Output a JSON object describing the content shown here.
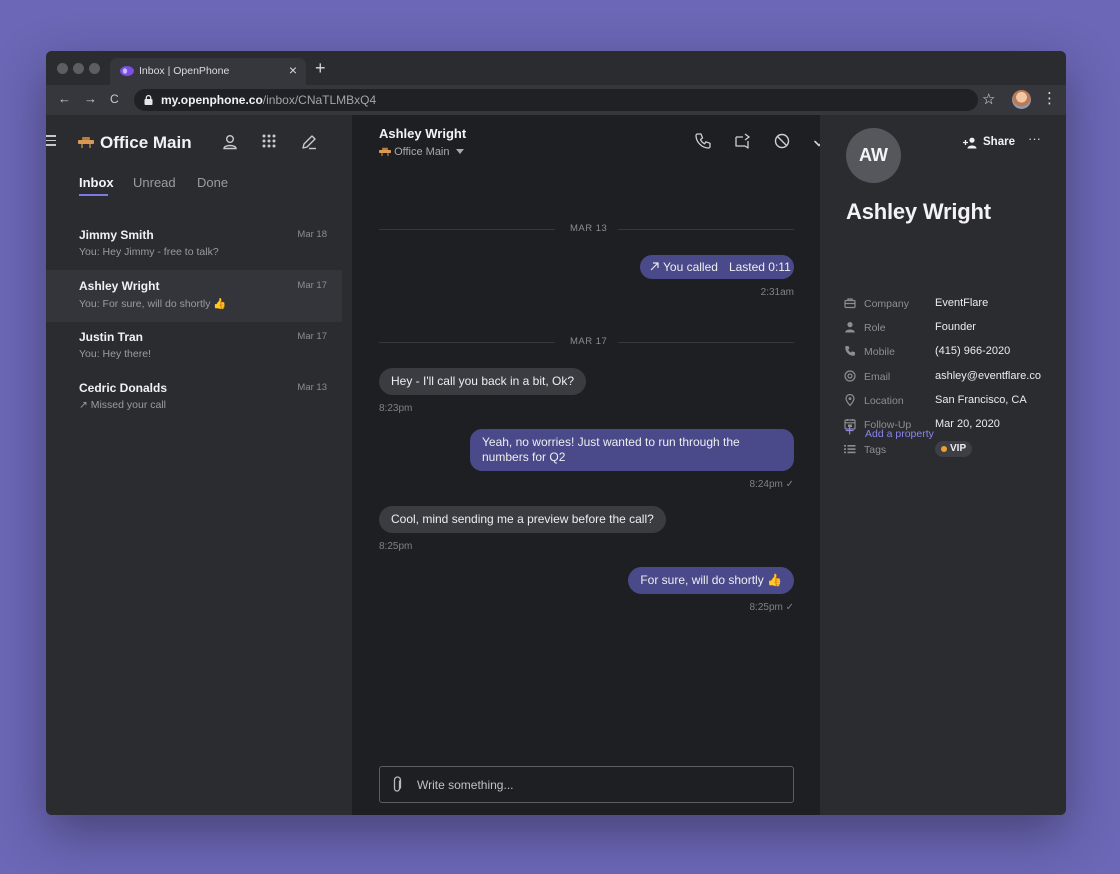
{
  "browser": {
    "tab_title": "Inbox | OpenPhone",
    "tab_close": "×",
    "new_tab": "+",
    "url_host": "my.openphone.co",
    "url_path": "/inbox/CNaTLMBxQ4",
    "back": "←",
    "forward": "→",
    "reload": "C",
    "star": "☆",
    "menu": "⋮"
  },
  "sidebar": {
    "workspace_name": "Office Main",
    "tabs": [
      {
        "label": "Inbox",
        "active": true
      },
      {
        "label": "Unread",
        "active": false
      },
      {
        "label": "Done",
        "active": false
      }
    ],
    "conversations": [
      {
        "name": "Jimmy Smith",
        "date": "Mar 18",
        "preview": "You: Hey Jimmy - free to talk?",
        "selected": false
      },
      {
        "name": "Ashley Wright",
        "date": "Mar 17",
        "preview": "You: For sure, will do shortly 👍",
        "selected": true
      },
      {
        "name": "Justin Tran",
        "date": "Mar 17",
        "preview": "You: Hey there!",
        "selected": false
      },
      {
        "name": "Cedric Donalds",
        "date": "Mar 13",
        "preview": "↗ Missed your call",
        "selected": false
      }
    ]
  },
  "chat": {
    "contact_name": "Ashley Wright",
    "inbox_name": "Office Main",
    "separators": [
      "MAR 13",
      "MAR 17"
    ],
    "call": {
      "label": "You called",
      "duration": "Lasted 0:11",
      "time": "2:31am"
    },
    "messages": [
      {
        "text": "Hey - I'll call you back in a bit, Ok?",
        "time": "8:23pm"
      },
      {
        "text": "Yeah, no worries! Just wanted to run through the numbers for Q2",
        "time": "8:24pm ✓"
      },
      {
        "text": "Cool, mind sending me a preview before the call?",
        "time": "8:25pm"
      },
      {
        "text": "For sure, will do shortly 👍",
        "time": "8:25pm ✓"
      }
    ],
    "composer_placeholder": "Write something..."
  },
  "contact": {
    "initials": "AW",
    "share_label": "Share",
    "more_label": "···",
    "name": "Ashley Wright",
    "properties": [
      {
        "label": "Company",
        "value": "EventFlare",
        "icon": "briefcase-icon"
      },
      {
        "label": "Role",
        "value": "Founder",
        "icon": "person-icon"
      },
      {
        "label": "Mobile",
        "value": "(415) 966-2020",
        "icon": "phone-icon"
      },
      {
        "label": "Email",
        "value": "ashley@eventflare.co",
        "icon": "at-icon"
      },
      {
        "label": "Location",
        "value": "San Francisco, CA",
        "icon": "pin-icon"
      },
      {
        "label": "Follow-Up",
        "value": "Mar 20, 2020",
        "icon": "calendar-icon"
      }
    ],
    "tags_label": "Tags",
    "tag": "VIP",
    "tag_color": "#f0a12c",
    "add_property": "Add a property"
  },
  "colors": {
    "accent": "#7f78e4",
    "outgoing_bubble": "#4a4a8a",
    "incoming_bubble": "#3b3c41",
    "background": "#6c67b6"
  }
}
